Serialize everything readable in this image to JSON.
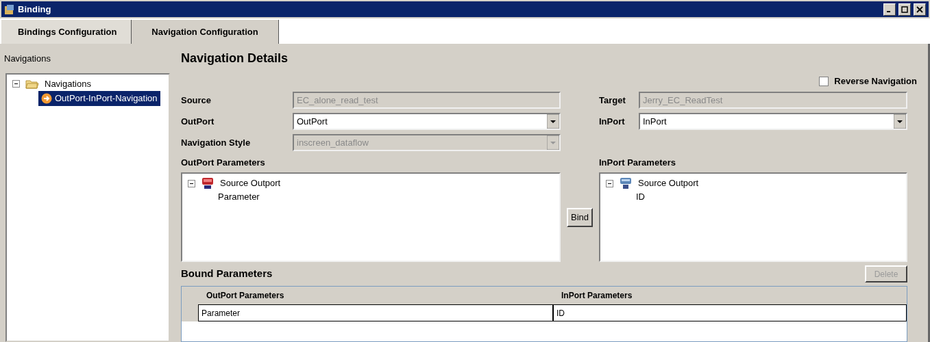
{
  "window": {
    "title": "Binding"
  },
  "tabs": [
    {
      "label": "Bindings Configuration",
      "selected": false
    },
    {
      "label": "Navigation Configuration",
      "selected": true
    }
  ],
  "sidebar": {
    "label": "Navigations",
    "tree": [
      {
        "label": "Navigations",
        "expanded": true,
        "children": [
          {
            "label": "OutPort-InPort-Navigation",
            "selected": true
          }
        ]
      }
    ]
  },
  "details": {
    "title": "Navigation Details",
    "reverse_navigation": {
      "label": "Reverse Navigation",
      "checked": false
    },
    "left_fields": [
      {
        "label": "Source",
        "kind": "text",
        "value": "EC_alone_read_test",
        "disabled": true
      },
      {
        "label": "OutPort",
        "kind": "dropdown",
        "value": "OutPort",
        "disabled": false
      },
      {
        "label": "Navigation Style",
        "kind": "dropdown",
        "value": "inscreen_dataflow",
        "disabled": true
      }
    ],
    "right_fields": [
      {
        "label": "Target",
        "kind": "text",
        "value": "Jerry_EC_ReadTest",
        "disabled": true
      },
      {
        "label": "InPort",
        "kind": "dropdown",
        "value": "InPort",
        "disabled": false
      }
    ],
    "outport_parameters": {
      "label": "OutPort Parameters",
      "tree": [
        {
          "label": "Source Outport",
          "kind": "out",
          "expanded": true,
          "children": [
            {
              "label": "Parameter"
            }
          ]
        }
      ]
    },
    "inport_parameters": {
      "label": "InPort Parameters",
      "tree": [
        {
          "label": "Source Outport",
          "kind": "in",
          "expanded": true,
          "children": [
            {
              "label": "ID"
            }
          ]
        }
      ]
    },
    "bind_button": "Bind"
  },
  "bound_parameters": {
    "title": "Bound Parameters",
    "delete": {
      "label": "Delete",
      "disabled": true
    },
    "columns": [
      "OutPort Parameters",
      "InPort Parameters"
    ],
    "rows": [
      [
        "Parameter",
        "ID"
      ]
    ]
  }
}
